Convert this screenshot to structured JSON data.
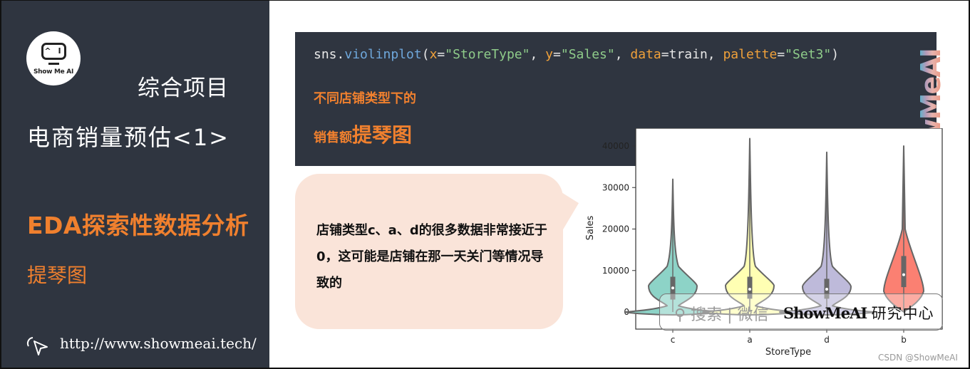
{
  "left_panel": {
    "logo_text": "Show Me AI",
    "logo_face": "^ I",
    "project_label": "综合项目",
    "title": "电商销量预估<1>",
    "section": "EDA探索性数据分析",
    "subsection": "提琴图",
    "url": "http://www.showmeai.tech/"
  },
  "code_panel": {
    "code_parts": [
      {
        "text": "sns.",
        "cls": ""
      },
      {
        "text": "violinplot",
        "cls": "c-fn"
      },
      {
        "text": "(",
        "cls": ""
      },
      {
        "text": "x",
        "cls": "c-kw"
      },
      {
        "text": "=",
        "cls": ""
      },
      {
        "text": "\"StoreType\"",
        "cls": "c-str"
      },
      {
        "text": ", ",
        "cls": ""
      },
      {
        "text": "y",
        "cls": "c-kw"
      },
      {
        "text": "=",
        "cls": ""
      },
      {
        "text": "\"Sales\"",
        "cls": "c-str"
      },
      {
        "text": ", ",
        "cls": ""
      },
      {
        "text": "data",
        "cls": "c-kw"
      },
      {
        "text": "=train, ",
        "cls": ""
      },
      {
        "text": "palette",
        "cls": "c-kw"
      },
      {
        "text": "=",
        "cls": ""
      },
      {
        "text": "\"Set3\"",
        "cls": "c-str"
      },
      {
        "text": ")",
        "cls": ""
      }
    ],
    "caption_line1": "不同店铺类型下的",
    "caption_line2_small": "销售额",
    "caption_line2_big": "提琴图"
  },
  "bubble": {
    "text": "店铺类型c、a、d的很多数据非常接近于0，这可能是店铺在那一天关门等情况导致的"
  },
  "watermark": {
    "vertical": "ShowMeAI",
    "search_text": "搜索 | 微信",
    "brand": "ShowMeAI",
    "brand_cn": "研究中心",
    "csdn": "CSDN @ShowMeAI"
  },
  "chart_data": {
    "type": "violin",
    "title": "",
    "xlabel": "StoreType",
    "ylabel": "Sales",
    "categories": [
      "c",
      "a",
      "d",
      "b"
    ],
    "colors": [
      "#8dd3c7",
      "#ffffb3",
      "#bebada",
      "#fb8072"
    ],
    "ylim": [
      -4000,
      43000
    ],
    "yticks": [
      0,
      10000,
      20000,
      30000,
      40000
    ],
    "ytick_labels": [
      "0",
      "10000",
      "20000",
      "30000",
      "40000"
    ],
    "series": [
      {
        "name": "c",
        "min": 0,
        "max": 32000,
        "q1": 3000,
        "median": 5800,
        "q3": 8500,
        "zero_spike": true
      },
      {
        "name": "a",
        "min": 0,
        "max": 41800,
        "q1": 3200,
        "median": 5500,
        "q3": 8500,
        "zero_spike": true
      },
      {
        "name": "d",
        "min": 0,
        "max": 38500,
        "q1": 3200,
        "median": 5500,
        "q3": 8000,
        "zero_spike": true
      },
      {
        "name": "b",
        "min": 0,
        "max": 40000,
        "q1": 6000,
        "median": 9000,
        "q3": 13500,
        "zero_spike": false
      }
    ]
  }
}
